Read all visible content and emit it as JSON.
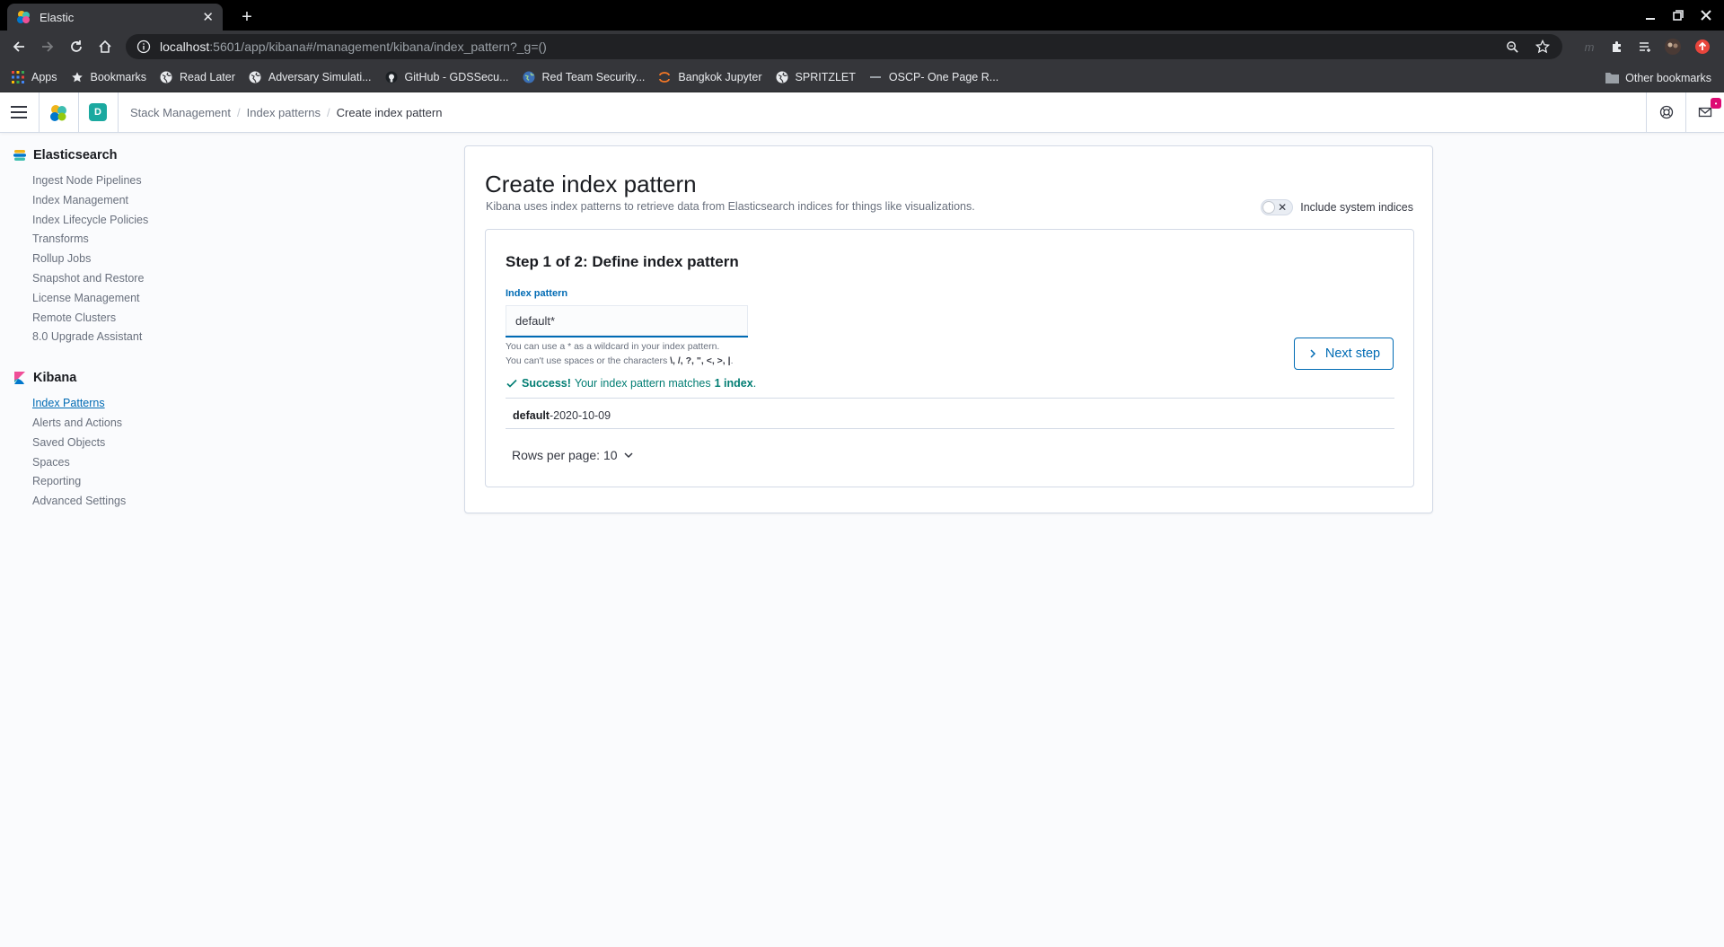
{
  "browser": {
    "tab_title": "Elastic",
    "url_host": "localhost",
    "url_path": ":5601/app/kibana#/management/kibana/index_pattern?_g=()",
    "bookmarks": [
      {
        "label": "Apps",
        "icon": "apps-grid-icon"
      },
      {
        "label": "Bookmarks",
        "icon": "star-icon"
      },
      {
        "label": "Read Later",
        "icon": "globe-icon"
      },
      {
        "label": "Adversary Simulati...",
        "icon": "globe-icon"
      },
      {
        "label": "GitHub - GDSSecu...",
        "icon": "github-icon"
      },
      {
        "label": "Red Team Security...",
        "icon": "globe-icon"
      },
      {
        "label": "Bangkok Jupyter",
        "icon": "jupyter-icon"
      },
      {
        "label": "SPRITZLET",
        "icon": "globe-icon"
      },
      {
        "label": "OSCP- One Page R...",
        "icon": "dash-icon"
      }
    ],
    "other_bookmarks": "Other bookmarks"
  },
  "header": {
    "space_initial": "D",
    "breadcrumbs": [
      "Stack Management",
      "Index patterns",
      "Create index pattern"
    ],
    "notification_badge": "•"
  },
  "sidebar": {
    "sections": [
      {
        "title": "Elasticsearch",
        "items": [
          "Ingest Node Pipelines",
          "Index Management",
          "Index Lifecycle Policies",
          "Transforms",
          "Rollup Jobs",
          "Snapshot and Restore",
          "License Management",
          "Remote Clusters",
          "8.0 Upgrade Assistant"
        ]
      },
      {
        "title": "Kibana",
        "items": [
          "Index Patterns",
          "Alerts and Actions",
          "Saved Objects",
          "Spaces",
          "Reporting",
          "Advanced Settings"
        ],
        "active": "Index Patterns"
      }
    ]
  },
  "main": {
    "title": "Create index pattern",
    "description": "Kibana uses index patterns to retrieve data from Elasticsearch indices for things like visualizations.",
    "toggle_label": "Include system indices",
    "toggle_on": false,
    "step_title": "Step 1 of 2: Define index pattern",
    "field_label": "Index pattern",
    "field_value": "default*",
    "help_line1": "You can use a * as a wildcard in your index pattern.",
    "help_line2_prefix": "You can't use spaces or the characters ",
    "help_line2_chars": "\\, /, ?, \", <, >, |",
    "help_line2_suffix": ".",
    "success_label": "Success!",
    "success_text": "Your index pattern matches",
    "success_count": "1 index",
    "success_end": ".",
    "index_match_bold": "default",
    "index_match_rest": "-2020-10-09",
    "rows_per_page": "Rows per page: 10",
    "next_button": "Next step"
  },
  "colors": {
    "primary": "#006bb4",
    "success": "#017d73",
    "space_avatar": "#1ba9a0",
    "badge": "#dd0a73"
  }
}
